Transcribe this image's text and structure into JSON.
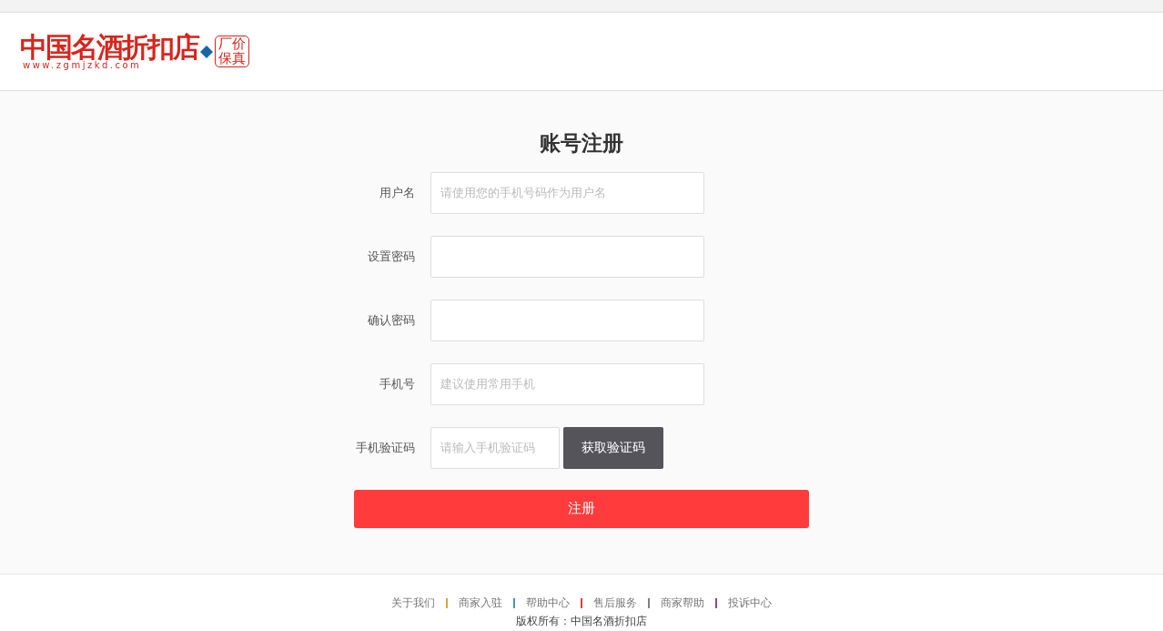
{
  "logo": {
    "name": "中国名酒折扣店",
    "url": "www.zgmjzkd.com",
    "stamp": [
      "厂价",
      "保真"
    ]
  },
  "form": {
    "title": "账号注册",
    "fields": [
      {
        "label": "用户名",
        "placeholder": "请使用您的手机号码作为用户名",
        "kind": "text"
      },
      {
        "label": "设置密码",
        "kind": "password"
      },
      {
        "label": "确认密码",
        "kind": "password"
      },
      {
        "label": "手机号",
        "placeholder": "建议使用常用手机",
        "kind": "text"
      },
      {
        "label": "手机验证码",
        "placeholder": "请输入手机验证码",
        "kind": "code",
        "button": "获取验证码"
      }
    ],
    "submit": "注册"
  },
  "footer": {
    "links": [
      {
        "label": "关于我们",
        "color": "#e0a040"
      },
      {
        "label": "商家入驻",
        "color": "#4a90c8"
      },
      {
        "label": "帮助中心",
        "color": "#e04040"
      },
      {
        "label": "售后服务",
        "color": "#808080"
      },
      {
        "label": "商家帮助",
        "color": "#a04080"
      },
      {
        "label": "投诉中心"
      }
    ],
    "copyright": "版权所有：中国名酒折扣店"
  }
}
